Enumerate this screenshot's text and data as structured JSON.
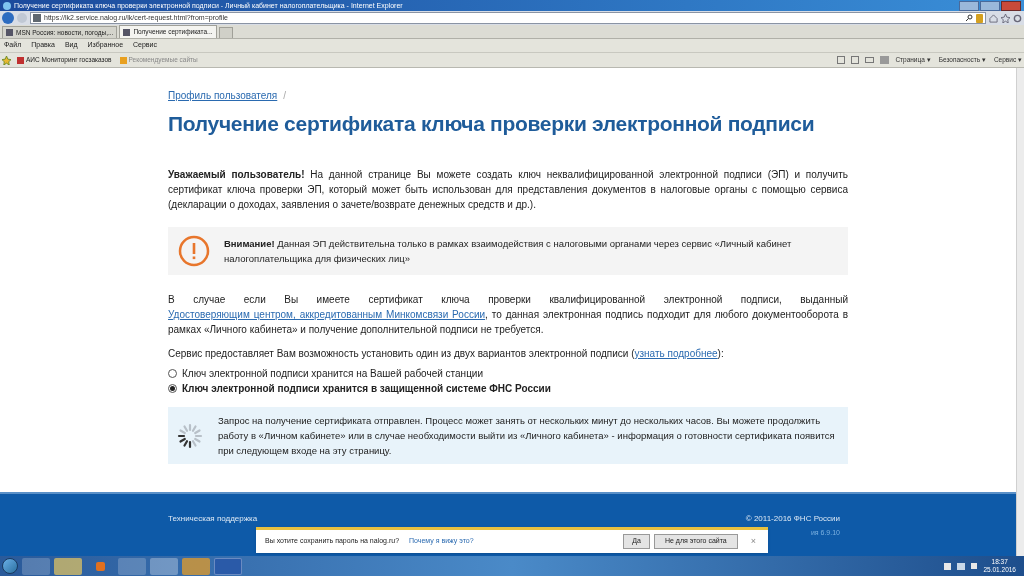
{
  "window": {
    "title": "Получение сертификата ключа проверки электронной подписи - Личный кабинет налогоплательщика - Internet Explorer"
  },
  "address_bar": {
    "url": "https://lk2.service.nalog.ru/lk/cert-request.html?from=profile"
  },
  "tabs": [
    {
      "label": "MSN Россия: новости, погоды,...",
      "selected": false
    },
    {
      "label": "Получение сертификата...",
      "selected": true
    }
  ],
  "menu": [
    "Файл",
    "Правка",
    "Вид",
    "Избранное",
    "Сервис"
  ],
  "favorites": [
    "АИС Мониторинг госзаказов",
    "Рекомендуемые сайты"
  ],
  "command_bar": [
    "Страница ▾",
    "Безопасность ▾",
    "Сервис ▾"
  ],
  "page": {
    "breadcrumb": "Профиль пользователя",
    "breadcrumb_separator": "/",
    "heading": "Получение сертификата ключа проверки электронной подписи",
    "intro": "**Уважаемый пользователь!** На данной странице Вы можете создать ключ неквалифицированной электронной подписи (ЭП) и получить сертификат ключа проверки ЭП, который может быть использован для представления документов в налоговые органы с помощью сервиса (декларации о доходах, заявления о зачете/возврате денежных средств и др.).",
    "warning": "**Внимание!** Данная ЭП действительна только в рамках взаимодействия с налоговыми органами через сервис «Личный кабинет налогоплательщика для физических лиц»",
    "qualified": {
      "before": "В случае если Вы имеете сертификат ключа проверки квалифицированной электронной подписи, выданный",
      "link": "Удостоверяющим центром, аккредитованным Минкомсвязи России",
      "after": ", то данная электронная подпись подходит для любого документооборота в рамках «Личного кабинета» и получение дополнительной подписи не требуется."
    },
    "variants": {
      "before": "Сервис предоставляет Вам возможность установить один из двух вариантов электронной подписи (",
      "link": "узнать подробнее",
      "after": "):"
    },
    "options": [
      {
        "label": "Ключ электронной подписи хранится на Вашей рабочей станции",
        "selected": false
      },
      {
        "label": "Ключ электронной подписи хранится в защищенной системе ФНС России",
        "selected": true
      }
    ],
    "info": "Запрос на получение сертификата отправлен. Процесс может занять от нескольких минут до нескольких часов. Вы можете продолжить работу в «Личном кабинете» или в случае необходимости выйти из «Личного кабинета» - информация о готовности сертификата появится при следующем входе на эту страницу."
  },
  "footer": {
    "support": "Техническая поддержка",
    "copyright": "© 2011-2016 ФНС России",
    "version": "ия 6.9.10"
  },
  "password_bar": {
    "question": "Вы хотите сохранить пароль на nalog.ru?",
    "link": "Почему я вижу это?",
    "buttons": [
      "Да",
      "Не для этого сайта"
    ],
    "close": "×"
  },
  "taskbar": {
    "time": "18:37",
    "date": "25.01.2016"
  }
}
